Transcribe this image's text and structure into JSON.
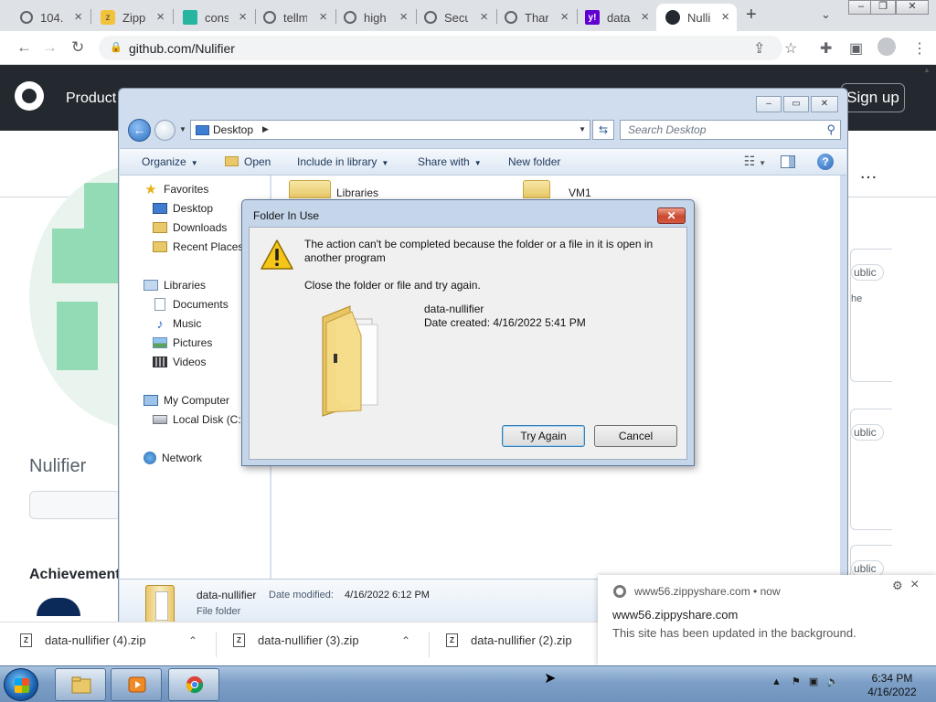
{
  "browser": {
    "tabs": [
      {
        "title": "104."
      },
      {
        "title": "Zipp"
      },
      {
        "title": "cons"
      },
      {
        "title": "tellm"
      },
      {
        "title": "high"
      },
      {
        "title": "Secu"
      },
      {
        "title": "Thar"
      },
      {
        "title": "data"
      },
      {
        "title": "Nulli"
      }
    ],
    "url": "github.com/Nulifier"
  },
  "github": {
    "product_label": "Product",
    "signup_label": "Sign up",
    "profile_name": "Nulifier",
    "achievements_label": "Achievements",
    "pill_label": "ublic",
    "snippet_text": "he"
  },
  "explorer": {
    "address": "Desktop",
    "search_placeholder": "Search Desktop",
    "commands": {
      "organize": "Organize",
      "open": "Open",
      "include_in_library": "Include in library",
      "share_with": "Share with",
      "new_folder": "New folder"
    },
    "nav": {
      "favorites": "Favorites",
      "desktop": "Desktop",
      "downloads": "Downloads",
      "recent_places": "Recent Places",
      "libraries": "Libraries",
      "documents": "Documents",
      "music": "Music",
      "pictures": "Pictures",
      "videos": "Videos",
      "my_computer": "My Computer",
      "local_disk": "Local Disk (C:)",
      "network": "Network"
    },
    "files": {
      "libraries": "Libraries",
      "vm1": "VM1"
    },
    "details": {
      "name": "data-nullifier",
      "modified_label": "Date modified:",
      "modified": "4/16/2022 6:12 PM",
      "type": "File folder"
    }
  },
  "dialog": {
    "title": "Folder In Use",
    "message": "The action can't be completed because the folder or a file in it is open in another program",
    "instruction": "Close the folder or file and try again.",
    "folder_name": "data-nullifier",
    "date_created": "Date created: 4/16/2022 5:41 PM",
    "try_again": "Try Again",
    "cancel": "Cancel"
  },
  "downloads": [
    {
      "file": "data-nullifier (4).zip"
    },
    {
      "file": "data-nullifier (3).zip"
    },
    {
      "file": "data-nullifier (2).zip"
    }
  ],
  "notification": {
    "source": "www56.zippyshare.com",
    "time": "now",
    "title": "www56.zippyshare.com",
    "message": "This site has been updated in the background."
  },
  "taskbar": {
    "time": "6:34 PM",
    "date": "4/16/2022"
  }
}
